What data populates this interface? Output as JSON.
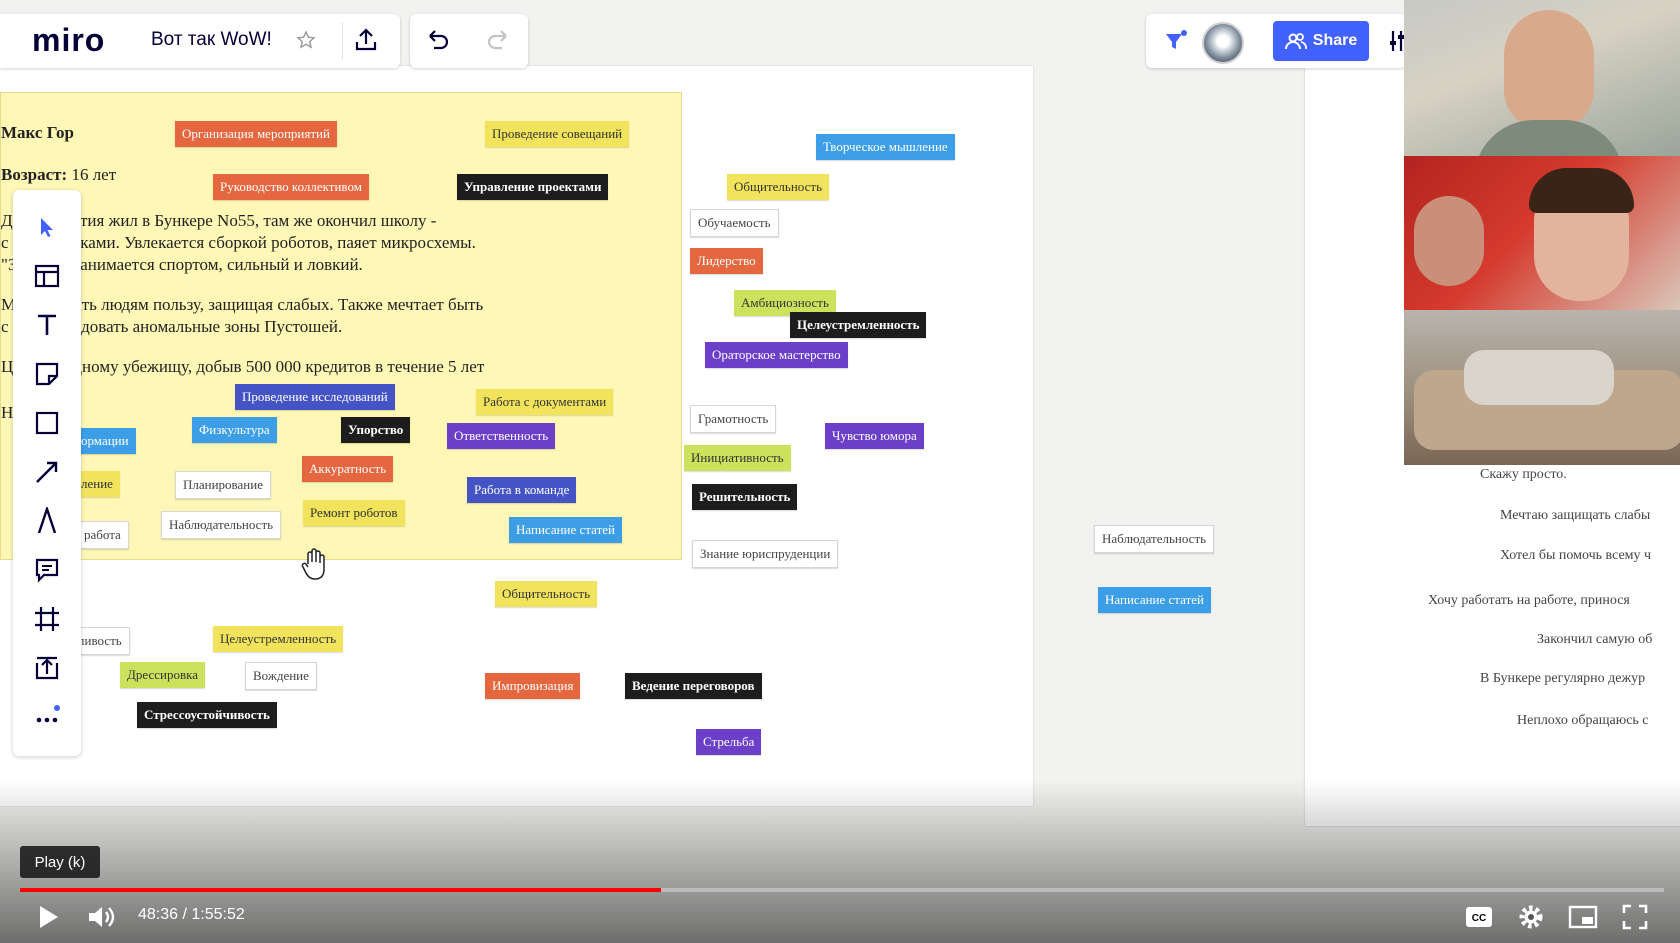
{
  "app": {
    "logo": "miro",
    "board_title": "Вот так WoW!",
    "share_label": "Share"
  },
  "card": {
    "name_line": "Макс Гор",
    "age_label": "Возраст:",
    "age_value": "16 лет",
    "bio_lines": [
      "Д    шеннолетия жил в Бункере No55, там же окончил школу -",
      "с    ими оценками. Увлекается сборкой роботов, паяет микросхемы.",
      "\"З   руки\"! Занимается спортом, сильный и ловкий.",
      "М   приносить людям пользу, защищая слабых. Также мечтает быть",
      "с    м и исследовать аномальные зоны Пустошей.",
      "Ц   мочь родному убежищу, добыв 500 000 кредитов в течение 5 лет",
      "Н"
    ]
  },
  "tags": [
    {
      "text": "Организация мероприятий",
      "color": "orange"
    },
    {
      "text": "Проведение совещаний",
      "color": "yellow"
    },
    {
      "text": "Руководство коллективом",
      "color": "orange"
    },
    {
      "text": "Управление проектами",
      "color": "black"
    },
    {
      "text": "Проведение исследований",
      "color": "indigo"
    },
    {
      "text": "Работа с документами",
      "color": "yellow"
    },
    {
      "text": "ормации",
      "color": "blue"
    },
    {
      "text": "Физкультура",
      "color": "blue"
    },
    {
      "text": "Упорство",
      "color": "black"
    },
    {
      "text": "Ответственность",
      "color": "purple"
    },
    {
      "text": "ление",
      "color": "yellow"
    },
    {
      "text": "Планирование",
      "color": "white"
    },
    {
      "text": "Аккуратность",
      "color": "orange"
    },
    {
      "text": "Работа в команде",
      "color": "indigo"
    },
    {
      "text": "работа",
      "color": "white"
    },
    {
      "text": "Наблюдательность",
      "color": "white"
    },
    {
      "text": "Ремонт роботов",
      "color": "yellow"
    },
    {
      "text": "Написание статей",
      "color": "blue"
    },
    {
      "text": "Творческое мышление",
      "color": "blue"
    },
    {
      "text": "Общительность",
      "color": "yellow"
    },
    {
      "text": "Обучаемость",
      "color": "white"
    },
    {
      "text": "Лидерство",
      "color": "orange"
    },
    {
      "text": "Амбициозность",
      "color": "lime"
    },
    {
      "text": "Целеустремленность",
      "color": "black"
    },
    {
      "text": "Ораторское мастерство",
      "color": "purple"
    },
    {
      "text": "Грамотность",
      "color": "white"
    },
    {
      "text": "Чувство юмора",
      "color": "purple"
    },
    {
      "text": "Инициативность",
      "color": "lime"
    },
    {
      "text": "Решительность",
      "color": "black"
    },
    {
      "text": "Знание юриспруденции",
      "color": "white"
    },
    {
      "text": "Общительность",
      "color": "yellow"
    },
    {
      "text": "ливость",
      "color": "white"
    },
    {
      "text": "Целеустремленность",
      "color": "yellow"
    },
    {
      "text": "Дрессировка",
      "color": "lime"
    },
    {
      "text": "Вождение",
      "color": "white"
    },
    {
      "text": "Стрессоустойчивость",
      "color": "black"
    },
    {
      "text": "Импровизация",
      "color": "orange"
    },
    {
      "text": "Ведение переговоров",
      "color": "black"
    },
    {
      "text": "Стрельба",
      "color": "purple"
    },
    {
      "text": "Наблюдательность",
      "color": "white"
    },
    {
      "text": "Написание статей",
      "color": "blue"
    }
  ],
  "right_list": [
    "Скажу просто.",
    "Мечтаю защищать слабы",
    "Хотел бы помочь всему ч",
    "Хочу работать на работе, принося",
    "Закончил самую об",
    "В Бункере регулярно дежур",
    "Неплохо обращаюсь с"
  ],
  "player": {
    "tooltip": "Play (k)",
    "time_current": "48:36",
    "time_separator": " / ",
    "time_total": "1:55:52",
    "progress": 0.39
  }
}
